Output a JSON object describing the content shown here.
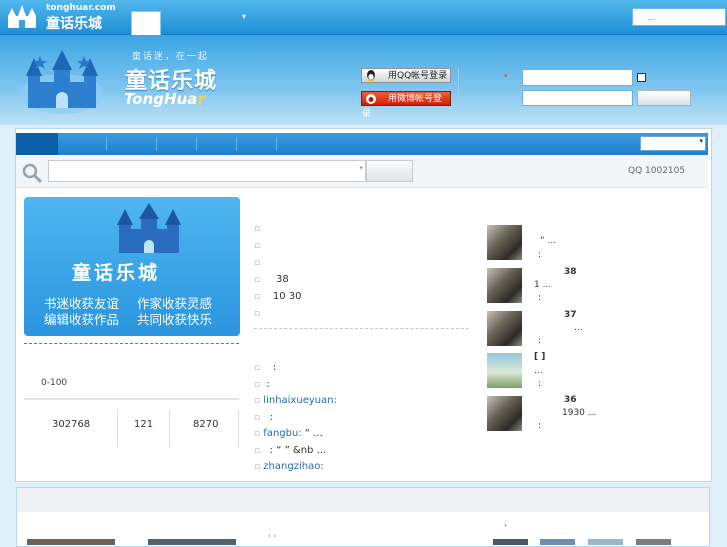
{
  "site": {
    "domain_logo": "tonghuar.com",
    "brand_cn": "童话乐城",
    "brand_en_main": "TongHua",
    "brand_en_tail": "r",
    "slogan": "童话迷，在一起"
  },
  "topbar": {
    "search_placeholder": "...",
    "caret": "▾"
  },
  "login": {
    "qq_label": "用QQ帐号登录",
    "weibo_label": "用微博帐号登录",
    "caret": "▾"
  },
  "search": {
    "dropdown_caret": "▾",
    "qq_group": "QQ 1002105"
  },
  "banner": {
    "title": "童话乐城",
    "left_line1": "书迷收获友谊",
    "left_line2": "编辑收获作品",
    "right_line1": "作家收获灵感",
    "right_line2": "共同收获快乐"
  },
  "level": {
    "range": "0-100"
  },
  "stats": [
    "302768",
    "121",
    "8270"
  ],
  "news_top": [
    {
      "bullet": "▫",
      "text": ""
    },
    {
      "bullet": "▫",
      "text": ""
    },
    {
      "bullet": "▫",
      "text": ""
    },
    {
      "bullet": "▫",
      "text": "38"
    },
    {
      "bullet": "▫",
      "text": "10  30"
    },
    {
      "bullet": "▫",
      "text": ""
    }
  ],
  "news_bottom": [
    {
      "bullet": "▫",
      "user": "",
      "text": ":"
    },
    {
      "bullet": "▫",
      "user": "",
      "text": ":"
    },
    {
      "bullet": "▫",
      "user": "linhaixueyuan:",
      "text": ""
    },
    {
      "bullet": "▫",
      "user": "",
      "text": ":"
    },
    {
      "bullet": "▫",
      "user": "fangbu:",
      "text": "        “ ..."
    },
    {
      "bullet": "▫",
      "user": "",
      "text": ":   “ ”   &nb ..."
    },
    {
      "bullet": "▫",
      "user": "zhangzihao:",
      "text": ""
    }
  ],
  "updates": [
    {
      "line1": "“          ...",
      "line2": ":"
    },
    {
      "line1": "38",
      "line2": "1          ...",
      "line3": ":"
    },
    {
      "line1": "37",
      "line2": "...",
      "line3": ":"
    },
    {
      "line1": "[    ]",
      "line2": "...",
      "line3": ":"
    },
    {
      "line1": "36",
      "line2": "1930    ...",
      "line3": ":"
    }
  ],
  "bottom": {
    "dot": "."
  }
}
